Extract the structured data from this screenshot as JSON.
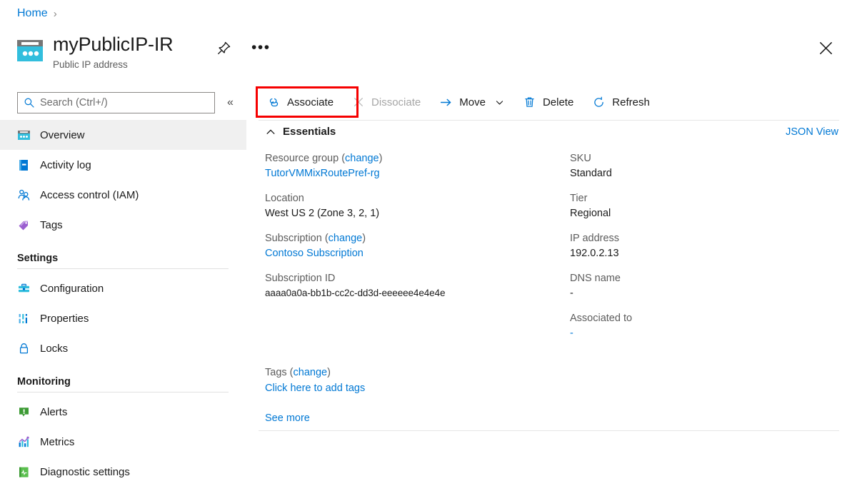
{
  "breadcrumb": {
    "home": "Home",
    "separator": "›"
  },
  "resource": {
    "title": "myPublicIP-IR",
    "subtitle": "Public IP address",
    "icon": "public-ip-address-icon",
    "pin_label": "Pin",
    "more_label": "•••"
  },
  "close": {
    "label": "✕"
  },
  "search": {
    "placeholder": "Search (Ctrl+/)",
    "value": "",
    "collapse": "«"
  },
  "sidebar": {
    "items": [
      {
        "label": "Overview",
        "icon": "public-ip-address-icon",
        "selected": true
      },
      {
        "label": "Activity log",
        "icon": "activity-log-icon",
        "selected": false
      },
      {
        "label": "Access control (IAM)",
        "icon": "access-control-icon",
        "selected": false
      },
      {
        "label": "Tags",
        "icon": "tags-icon",
        "selected": false
      }
    ],
    "sections": [
      {
        "title": "Settings",
        "items": [
          {
            "label": "Configuration",
            "icon": "configuration-icon"
          },
          {
            "label": "Properties",
            "icon": "properties-icon"
          },
          {
            "label": "Locks",
            "icon": "locks-icon"
          }
        ]
      },
      {
        "title": "Monitoring",
        "items": [
          {
            "label": "Alerts",
            "icon": "alerts-icon"
          },
          {
            "label": "Metrics",
            "icon": "metrics-icon"
          },
          {
            "label": "Diagnostic settings",
            "icon": "diagnostic-settings-icon"
          }
        ]
      }
    ]
  },
  "toolbar": {
    "associate": "Associate",
    "dissociate": "Dissociate",
    "move": "Move",
    "move_chevron": "⌄",
    "delete": "Delete",
    "refresh": "Refresh",
    "highlight_color": "#f60000"
  },
  "essentials": {
    "header": "Essentials",
    "collapse_icon": "chevron-up-icon",
    "json_view": "JSON View",
    "left": [
      {
        "key": "Resource group",
        "key_link": "change",
        "value": "TutorVMMixRoutePref-rg",
        "value_is_link": true
      },
      {
        "key": "Location",
        "key_link": "",
        "value": "West US 2 (Zone 3, 2, 1)",
        "value_is_link": false
      },
      {
        "key": "Subscription",
        "key_link": "change",
        "value": "Contoso Subscription",
        "value_is_link": true
      },
      {
        "key": "Subscription ID",
        "key_link": "",
        "value": "aaaa0a0a-bb1b-cc2c-dd3d-eeeeee4e4e4e",
        "value_is_link": false,
        "mono": true
      }
    ],
    "right": [
      {
        "key": "SKU",
        "value": "Standard",
        "value_is_link": false
      },
      {
        "key": "Tier",
        "value": "Regional",
        "value_is_link": false
      },
      {
        "key": "IP address",
        "value": "192.0.2.13",
        "value_is_link": false
      },
      {
        "key": "DNS name",
        "value": "-",
        "value_is_link": false
      },
      {
        "key": "Associated to",
        "value": "-",
        "value_is_link": true
      }
    ]
  },
  "tags": {
    "key": "Tags",
    "key_link": "change",
    "value": "Click here to add tags"
  },
  "see_more": "See more",
  "colors": {
    "link": "#0078d4",
    "accent_cyan": "#32bedd",
    "selected_row": "#f0f0f0",
    "highlight": "#f60000"
  }
}
